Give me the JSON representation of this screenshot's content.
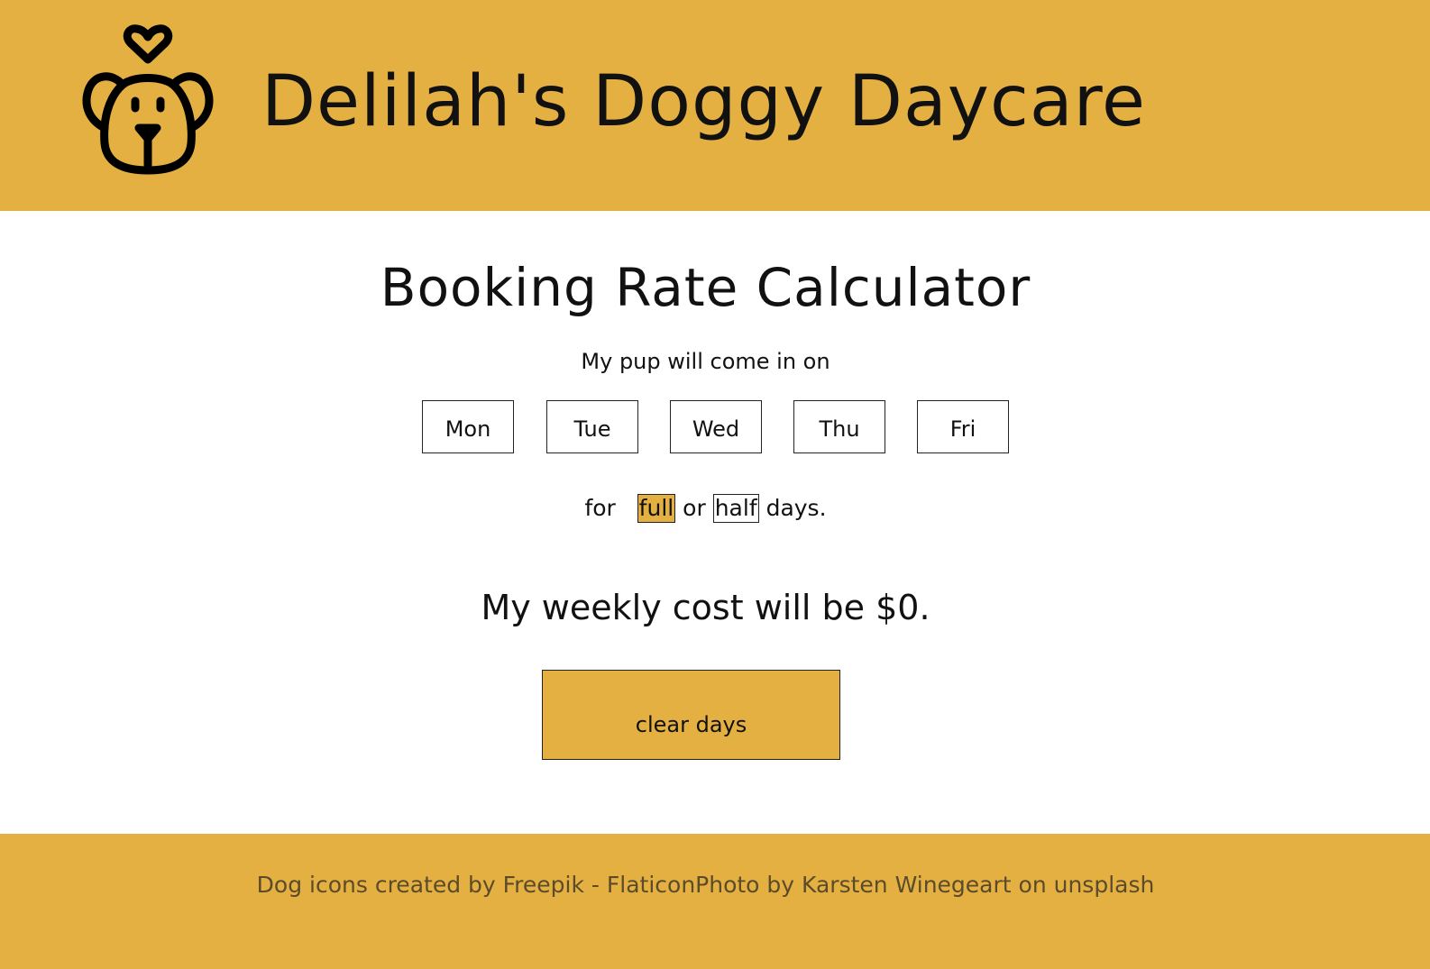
{
  "header": {
    "site_title": "Delilah's Doggy Daycare",
    "logo_icon": "dog-head-with-heart-icon"
  },
  "calculator": {
    "title": "Booking Rate Calculator",
    "intro": "My pup will come in on",
    "days": [
      "Mon",
      "Tue",
      "Wed",
      "Thu",
      "Fri"
    ],
    "duration_prefix": "for",
    "full_label": "full",
    "or_text": "or",
    "half_label": "half",
    "duration_suffix": "days.",
    "selected_duration": "full",
    "cost_text": "My weekly cost will be $0.",
    "clear_button": "clear days"
  },
  "footer": {
    "credits": "Dog icons created by Freepik - FlaticonPhoto by Karsten Winegeart on unsplash"
  },
  "colors": {
    "accent": "#e4b042",
    "text": "#111111",
    "background": "#ffffff"
  }
}
